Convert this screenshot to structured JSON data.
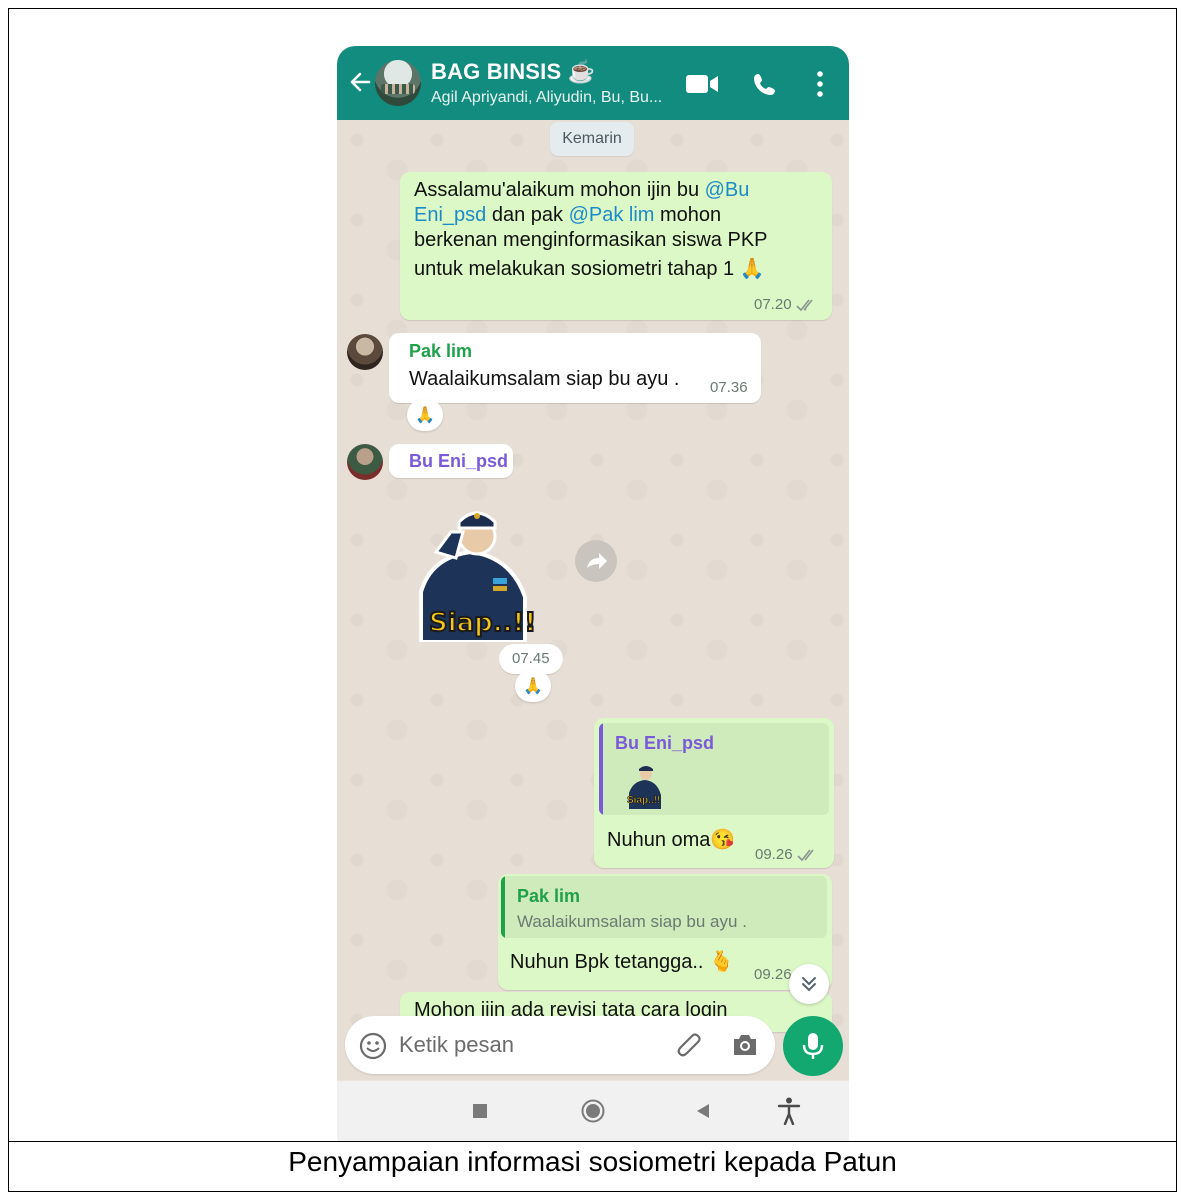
{
  "header": {
    "title": "BAG BINSIS ☕",
    "subtitle": "Agil Apriyandi, Aliyudin, Bu, Bu..."
  },
  "date_chip": "Kemarin",
  "messages": {
    "m1": {
      "parts": [
        "Assalamu'alaikum mohon ijin bu ",
        "@Bu",
        "Eni_psd",
        " dan pak ",
        "@Pak lim",
        " mohon",
        "berkenan menginformasikan siswa PKP",
        "untuk melakukan sosiometri tahap 1 🙏"
      ],
      "time": "07.20"
    },
    "m2": {
      "sender": "Pak lim",
      "text": "Waalaikumsalam siap bu ayu .",
      "time": "07.36",
      "reaction": "🙏"
    },
    "m3": {
      "sender": "Bu Eni_psd",
      "sticker_text": "Siap..!!",
      "time": "07.45",
      "reaction": "🙏"
    },
    "m4": {
      "quote_sender": "Bu Eni_psd",
      "quote_sticker_text": "Siap..!!",
      "text": "Nuhun oma😘",
      "time": "09.26"
    },
    "m5": {
      "quote_sender": "Pak lim",
      "quote_text": "Waalaikumsalam siap bu ayu .",
      "text": "Nuhun Bpk tetangga.. 🫰",
      "time": "09.26"
    },
    "m6_partial": "Mohon ijin ada revisi tata cara login"
  },
  "input": {
    "placeholder": "Ketik pesan"
  },
  "icons": {
    "back": "arrow-left-icon",
    "video": "video-call-icon",
    "call": "phone-icon",
    "menu": "more-vert-icon",
    "emoji": "emoji-icon",
    "attach": "paperclip-icon",
    "camera": "camera-icon",
    "mic": "mic-icon",
    "forward": "forward-icon",
    "scroll": "chevron-double-down-icon"
  },
  "colors": {
    "header": "#128c7e",
    "outgoing": "#dcf8c6",
    "incoming": "#ffffff",
    "mic": "#12a86f"
  },
  "caption": "Penyampaian informasi sosiometri kepada Patun"
}
